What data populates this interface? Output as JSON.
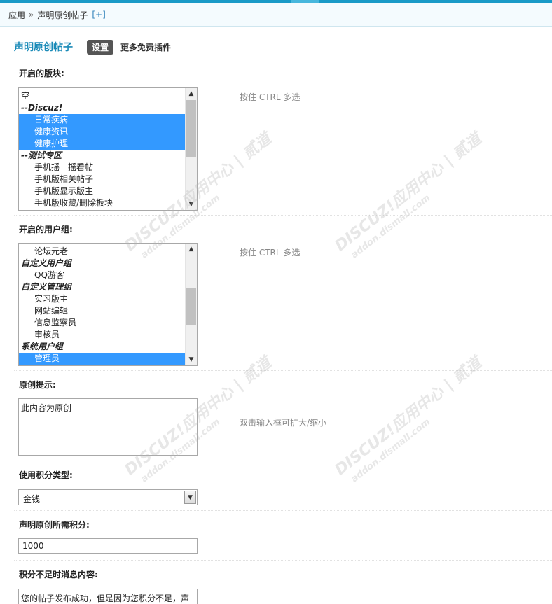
{
  "breadcrumb": {
    "root": "应用",
    "separator": "»",
    "current": "声明原创帖子",
    "add": "[+]"
  },
  "header": {
    "title": "声明原创帖子",
    "tab_settings": "设置",
    "more_plugins": "更多免费插件"
  },
  "forums": {
    "label": "开启的版块:",
    "hint": "按住 CTRL 多选",
    "options": [
      {
        "text": "空",
        "type": "item",
        "selected": false
      },
      {
        "text": "--Discuz!",
        "type": "group",
        "selected": false
      },
      {
        "text": "日常疾病",
        "type": "child",
        "selected": true
      },
      {
        "text": "健康资讯",
        "type": "child",
        "selected": true
      },
      {
        "text": "健康护理",
        "type": "child",
        "selected": true
      },
      {
        "text": "--测试专区",
        "type": "group",
        "selected": false
      },
      {
        "text": "手机摇一摇看帖",
        "type": "child",
        "selected": false
      },
      {
        "text": "手机版相关帖子",
        "type": "child",
        "selected": false
      },
      {
        "text": "手机版显示版主",
        "type": "child",
        "selected": false
      },
      {
        "text": "手机版收藏/删除板块",
        "type": "child",
        "selected": false
      }
    ]
  },
  "usergroups": {
    "label": "开启的用户组:",
    "hint": "按住 CTRL 多选",
    "options": [
      {
        "text": "论坛元老",
        "type": "child",
        "selected": false
      },
      {
        "text": "自定义用户组",
        "type": "group",
        "selected": false
      },
      {
        "text": "QQ游客",
        "type": "child",
        "selected": false
      },
      {
        "text": "自定义管理组",
        "type": "group",
        "selected": false
      },
      {
        "text": "实习版主",
        "type": "child",
        "selected": false
      },
      {
        "text": "网站编辑",
        "type": "child",
        "selected": false
      },
      {
        "text": "信息监察员",
        "type": "child",
        "selected": false
      },
      {
        "text": "审核员",
        "type": "child",
        "selected": false
      },
      {
        "text": "系统用户组",
        "type": "group",
        "selected": false
      },
      {
        "text": "管理员",
        "type": "child",
        "selected": true
      }
    ]
  },
  "original_tip": {
    "label": "原创提示:",
    "value": "此内容为原创",
    "hint": "双击输入框可扩大/缩小"
  },
  "credit_type": {
    "label": "使用积分类型:",
    "selected": "金钱"
  },
  "required_credits": {
    "label": "声明原创所需积分:",
    "value": "1000"
  },
  "insufficient_msg": {
    "label": "积分不足时消息内容:",
    "value": "您的帖子发布成功，但是因为您积分不足，声"
  },
  "watermark": {
    "brand": "DISCUZ!应用中心",
    "url": "addon.dismall.com",
    "mark": "贰道"
  },
  "colors": {
    "accent": "#1a9ac7",
    "title": "#1b8bb8",
    "selection": "#3399ff"
  }
}
